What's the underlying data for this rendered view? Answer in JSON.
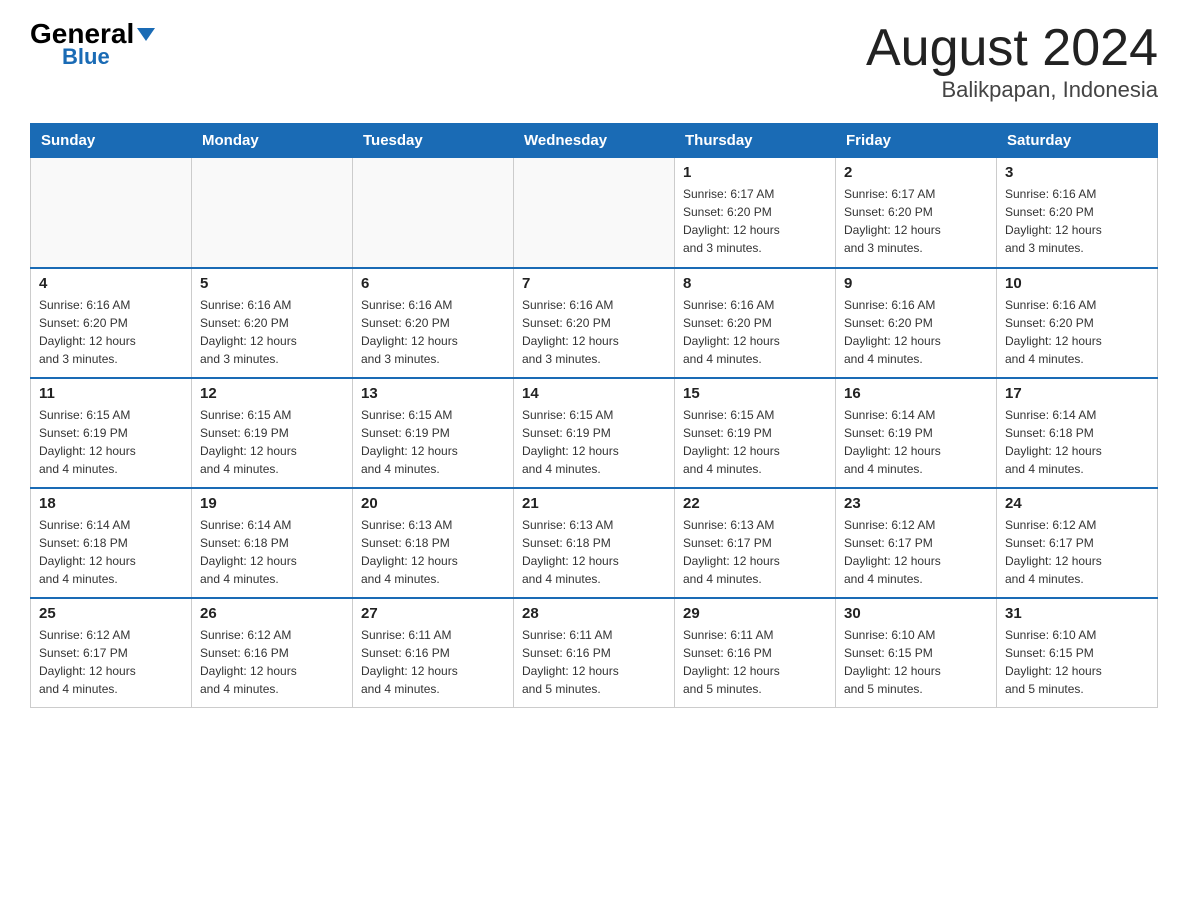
{
  "header": {
    "logo_general": "General",
    "logo_blue": "Blue",
    "month_title": "August 2024",
    "location": "Balikpapan, Indonesia"
  },
  "days_of_week": [
    "Sunday",
    "Monday",
    "Tuesday",
    "Wednesday",
    "Thursday",
    "Friday",
    "Saturday"
  ],
  "weeks": [
    [
      {
        "day": "",
        "info": ""
      },
      {
        "day": "",
        "info": ""
      },
      {
        "day": "",
        "info": ""
      },
      {
        "day": "",
        "info": ""
      },
      {
        "day": "1",
        "info": "Sunrise: 6:17 AM\nSunset: 6:20 PM\nDaylight: 12 hours\nand 3 minutes."
      },
      {
        "day": "2",
        "info": "Sunrise: 6:17 AM\nSunset: 6:20 PM\nDaylight: 12 hours\nand 3 minutes."
      },
      {
        "day": "3",
        "info": "Sunrise: 6:16 AM\nSunset: 6:20 PM\nDaylight: 12 hours\nand 3 minutes."
      }
    ],
    [
      {
        "day": "4",
        "info": "Sunrise: 6:16 AM\nSunset: 6:20 PM\nDaylight: 12 hours\nand 3 minutes."
      },
      {
        "day": "5",
        "info": "Sunrise: 6:16 AM\nSunset: 6:20 PM\nDaylight: 12 hours\nand 3 minutes."
      },
      {
        "day": "6",
        "info": "Sunrise: 6:16 AM\nSunset: 6:20 PM\nDaylight: 12 hours\nand 3 minutes."
      },
      {
        "day": "7",
        "info": "Sunrise: 6:16 AM\nSunset: 6:20 PM\nDaylight: 12 hours\nand 3 minutes."
      },
      {
        "day": "8",
        "info": "Sunrise: 6:16 AM\nSunset: 6:20 PM\nDaylight: 12 hours\nand 4 minutes."
      },
      {
        "day": "9",
        "info": "Sunrise: 6:16 AM\nSunset: 6:20 PM\nDaylight: 12 hours\nand 4 minutes."
      },
      {
        "day": "10",
        "info": "Sunrise: 6:16 AM\nSunset: 6:20 PM\nDaylight: 12 hours\nand 4 minutes."
      }
    ],
    [
      {
        "day": "11",
        "info": "Sunrise: 6:15 AM\nSunset: 6:19 PM\nDaylight: 12 hours\nand 4 minutes."
      },
      {
        "day": "12",
        "info": "Sunrise: 6:15 AM\nSunset: 6:19 PM\nDaylight: 12 hours\nand 4 minutes."
      },
      {
        "day": "13",
        "info": "Sunrise: 6:15 AM\nSunset: 6:19 PM\nDaylight: 12 hours\nand 4 minutes."
      },
      {
        "day": "14",
        "info": "Sunrise: 6:15 AM\nSunset: 6:19 PM\nDaylight: 12 hours\nand 4 minutes."
      },
      {
        "day": "15",
        "info": "Sunrise: 6:15 AM\nSunset: 6:19 PM\nDaylight: 12 hours\nand 4 minutes."
      },
      {
        "day": "16",
        "info": "Sunrise: 6:14 AM\nSunset: 6:19 PM\nDaylight: 12 hours\nand 4 minutes."
      },
      {
        "day": "17",
        "info": "Sunrise: 6:14 AM\nSunset: 6:18 PM\nDaylight: 12 hours\nand 4 minutes."
      }
    ],
    [
      {
        "day": "18",
        "info": "Sunrise: 6:14 AM\nSunset: 6:18 PM\nDaylight: 12 hours\nand 4 minutes."
      },
      {
        "day": "19",
        "info": "Sunrise: 6:14 AM\nSunset: 6:18 PM\nDaylight: 12 hours\nand 4 minutes."
      },
      {
        "day": "20",
        "info": "Sunrise: 6:13 AM\nSunset: 6:18 PM\nDaylight: 12 hours\nand 4 minutes."
      },
      {
        "day": "21",
        "info": "Sunrise: 6:13 AM\nSunset: 6:18 PM\nDaylight: 12 hours\nand 4 minutes."
      },
      {
        "day": "22",
        "info": "Sunrise: 6:13 AM\nSunset: 6:17 PM\nDaylight: 12 hours\nand 4 minutes."
      },
      {
        "day": "23",
        "info": "Sunrise: 6:12 AM\nSunset: 6:17 PM\nDaylight: 12 hours\nand 4 minutes."
      },
      {
        "day": "24",
        "info": "Sunrise: 6:12 AM\nSunset: 6:17 PM\nDaylight: 12 hours\nand 4 minutes."
      }
    ],
    [
      {
        "day": "25",
        "info": "Sunrise: 6:12 AM\nSunset: 6:17 PM\nDaylight: 12 hours\nand 4 minutes."
      },
      {
        "day": "26",
        "info": "Sunrise: 6:12 AM\nSunset: 6:16 PM\nDaylight: 12 hours\nand 4 minutes."
      },
      {
        "day": "27",
        "info": "Sunrise: 6:11 AM\nSunset: 6:16 PM\nDaylight: 12 hours\nand 4 minutes."
      },
      {
        "day": "28",
        "info": "Sunrise: 6:11 AM\nSunset: 6:16 PM\nDaylight: 12 hours\nand 5 minutes."
      },
      {
        "day": "29",
        "info": "Sunrise: 6:11 AM\nSunset: 6:16 PM\nDaylight: 12 hours\nand 5 minutes."
      },
      {
        "day": "30",
        "info": "Sunrise: 6:10 AM\nSunset: 6:15 PM\nDaylight: 12 hours\nand 5 minutes."
      },
      {
        "day": "31",
        "info": "Sunrise: 6:10 AM\nSunset: 6:15 PM\nDaylight: 12 hours\nand 5 minutes."
      }
    ]
  ]
}
